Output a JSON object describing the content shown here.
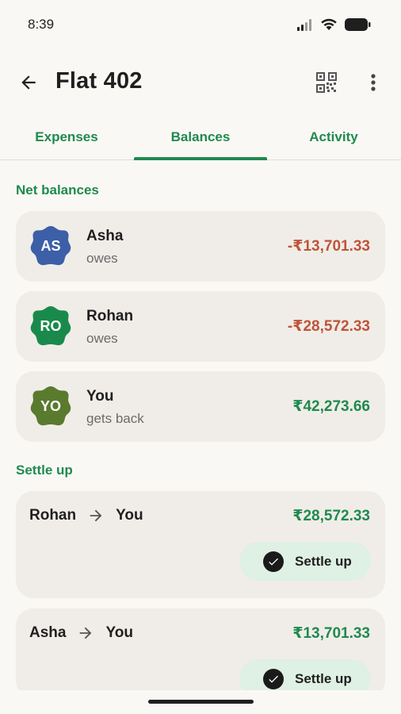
{
  "status_bar": {
    "time": "8:39"
  },
  "app_bar": {
    "title": "Flat 402"
  },
  "tabs": [
    {
      "label": "Expenses"
    },
    {
      "label": "Balances"
    },
    {
      "label": "Activity"
    }
  ],
  "net_balances": {
    "title": "Net balances",
    "items": [
      {
        "initials": "AS",
        "name": "Asha",
        "status": "owes",
        "amount": "-₹13,701.33",
        "avatar_color": "#3c5fa8"
      },
      {
        "initials": "RO",
        "name": "Rohan",
        "status": "owes",
        "amount": "-₹28,572.33",
        "avatar_color": "#1a8a4c"
      },
      {
        "initials": "YO",
        "name": "You",
        "status": "gets back",
        "amount": "₹42,273.66",
        "avatar_color": "#5a7a2e"
      }
    ]
  },
  "settle_up": {
    "title": "Settle up",
    "items": [
      {
        "from": "Rohan",
        "to": "You",
        "amount": "₹28,572.33",
        "button_label": "Settle up"
      },
      {
        "from": "Asha",
        "to": "You",
        "amount": "₹13,701.33",
        "button_label": "Settle up"
      }
    ]
  },
  "colors": {
    "accent": "#1f8a4f",
    "negative": "#c0533a",
    "card": "#f0ede8",
    "background": "#faf8f4"
  }
}
